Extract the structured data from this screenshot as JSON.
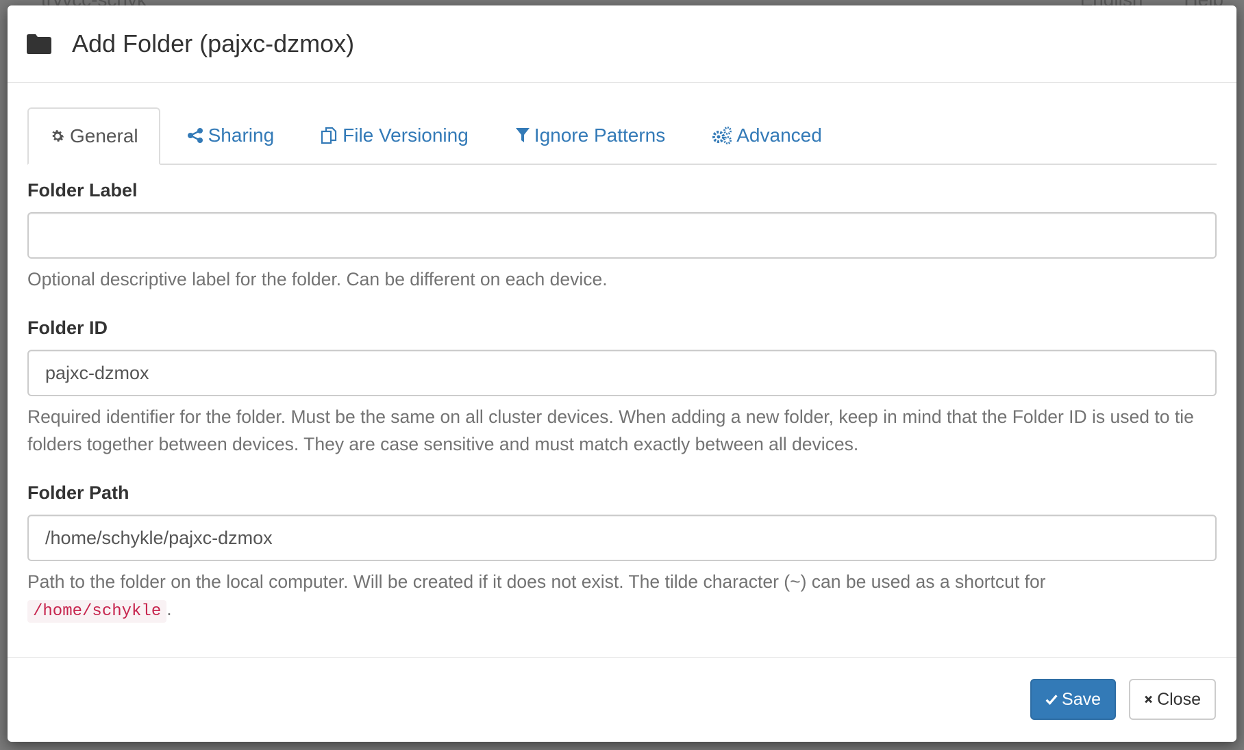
{
  "background": {
    "top_left_text": "tryvcc-schyk",
    "top_right_language": "English",
    "top_right_help": "Help"
  },
  "dialog": {
    "title": "Add Folder (pajxc-dzmox)",
    "icon": "folder-icon"
  },
  "tabs": [
    {
      "label": "General",
      "icon": "gear-icon",
      "active": true
    },
    {
      "label": "Sharing",
      "icon": "share-icon",
      "active": false
    },
    {
      "label": "File Versioning",
      "icon": "copy-icon",
      "active": false
    },
    {
      "label": "Ignore Patterns",
      "icon": "filter-icon",
      "active": false
    },
    {
      "label": "Advanced",
      "icon": "cogs-icon",
      "active": false
    }
  ],
  "form": {
    "folder_label": {
      "label": "Folder Label",
      "value": "",
      "help": "Optional descriptive label for the folder. Can be different on each device."
    },
    "folder_id": {
      "label": "Folder ID",
      "value": "pajxc-dzmox",
      "help": "Required identifier for the folder. Must be the same on all cluster devices. When adding a new folder, keep in mind that the Folder ID is used to tie folders together between devices. They are case sensitive and must match exactly between all devices."
    },
    "folder_path": {
      "label": "Folder Path",
      "value": "/home/schykle/pajxc-dzmox",
      "help": "Path to the folder on the local computer. Will be created if it does not exist. The tilde character (~) can be used as a shortcut for",
      "help_code": "/home/schykle",
      "help_suffix": "."
    }
  },
  "footer": {
    "save_label": "Save",
    "close_label": "Close"
  },
  "colors": {
    "primary": "#337ab7",
    "code_text": "#c7254e",
    "code_bg": "#f9f2f4"
  }
}
